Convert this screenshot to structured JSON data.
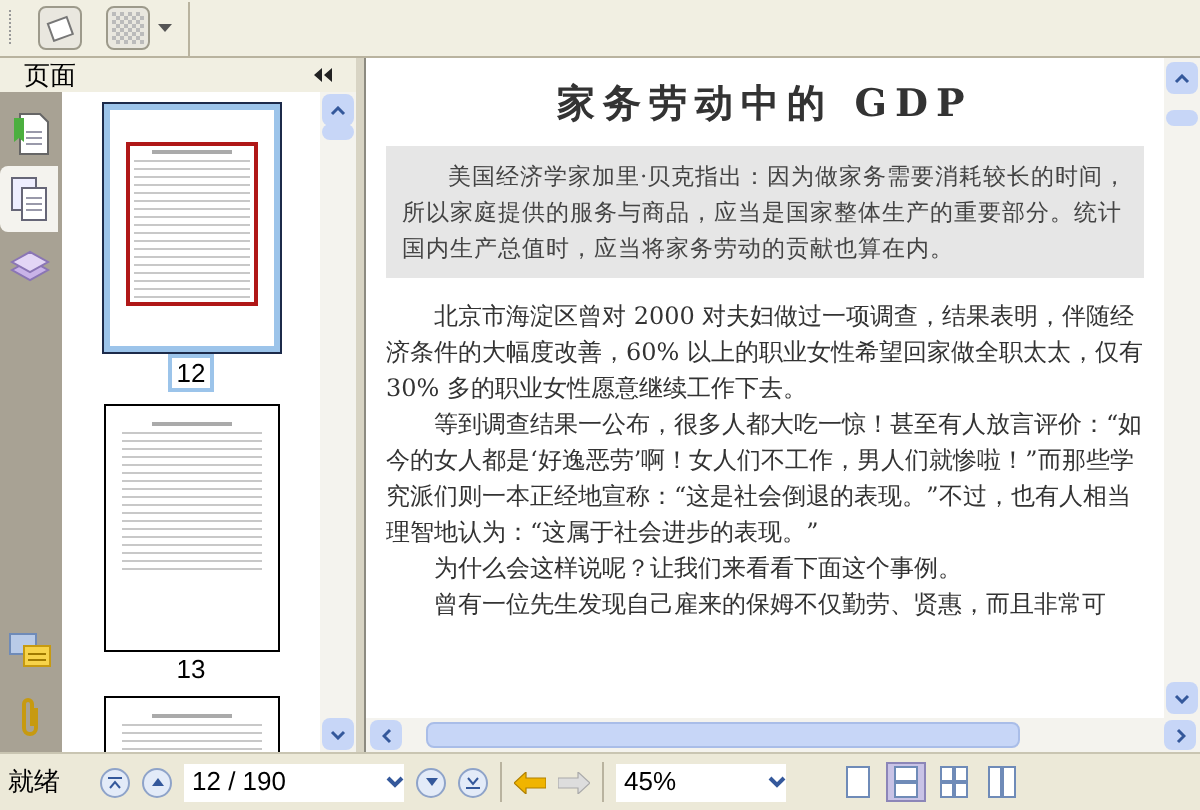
{
  "panel": {
    "title": "页面"
  },
  "side_tabs": [
    {
      "kind": "bookmarks",
      "selected": false
    },
    {
      "kind": "pages",
      "selected": true
    },
    {
      "kind": "layers",
      "selected": false
    },
    {
      "kind": "comments",
      "selected": false
    },
    {
      "kind": "attachments",
      "selected": false
    }
  ],
  "thumbnails": [
    {
      "label": "12",
      "selected": true
    },
    {
      "label": "13",
      "selected": false
    },
    {
      "selected": false
    }
  ],
  "document": {
    "title": "家务劳动中的 GDP",
    "quote": "美国经济学家加里·贝克指出：因为做家务需要消耗较长的时间，所以家庭提供的服务与商品，应当是国家整体生产的重要部分。统计国内生产总值时，应当将家务劳动的贡献也算在内。",
    "paragraphs": [
      "北京市海淀区曾对 2000 对夫妇做过一项调查，结果表明，伴随经济条件的大幅度改善，60% 以上的职业女性希望回家做全职太太，仅有 30% 多的职业女性愿意继续工作下去。",
      "等到调查结果一公布，很多人都大吃一惊！甚至有人放言评价：“如今的女人都是‘好逸恶劳’啊！女人们不工作，男人们就惨啦！”而那些学究派们则一本正经地宣称：“这是社会倒退的表现。”不过，也有人相当理智地认为：“这属于社会进步的表现。”",
      "为什么会这样说呢？让我们来看看下面这个事例。",
      "曾有一位先生发现自己雇来的保姆不仅勤劳、贤惠，而且非常可"
    ]
  },
  "status_bar": {
    "status": "就绪",
    "page_field": "12 / 190",
    "zoom": "45%",
    "view_modes": [
      {
        "kind": "single",
        "selected": false
      },
      {
        "kind": "continuous",
        "selected": true
      },
      {
        "kind": "facing",
        "selected": false
      },
      {
        "kind": "continuous_facing",
        "selected": false
      }
    ]
  }
}
